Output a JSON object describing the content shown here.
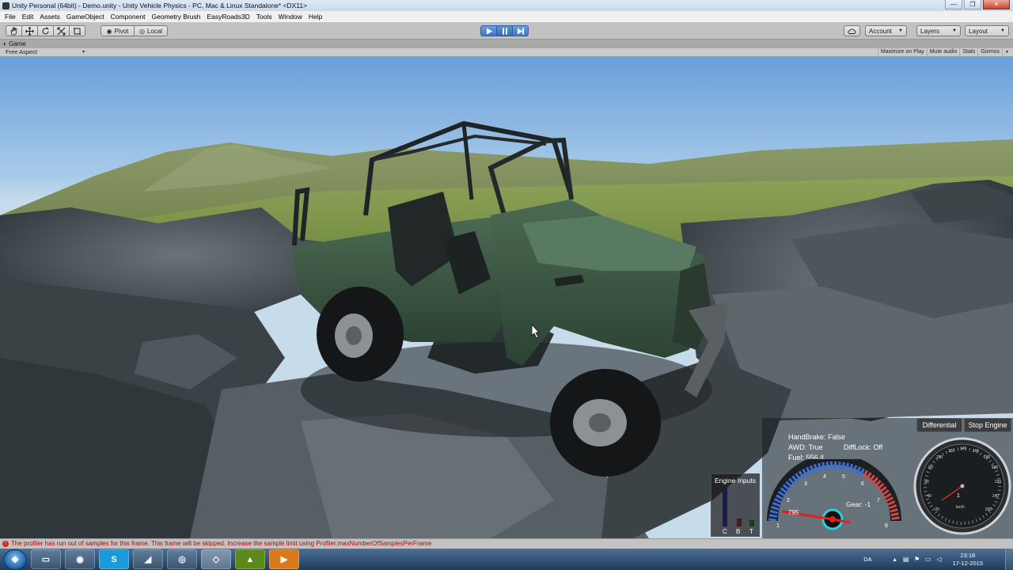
{
  "window": {
    "title": "Unity Personal (64bit) - Demo.unity - Unity Vehicle Physics - PC, Mac & Linux Standalone* <DX11>",
    "minimize": "—",
    "maximize": "❐",
    "close": "✕"
  },
  "menu": [
    "File",
    "Edit",
    "Assets",
    "GameObject",
    "Component",
    "Geometry Brush",
    "EasyRoads3D",
    "Tools",
    "Window",
    "Help"
  ],
  "toolbar": {
    "pivot": "Pivot",
    "local": "Local",
    "account": "Account",
    "layers": "Layers",
    "layout": "Layout"
  },
  "game_tab": {
    "label": "Game"
  },
  "game_bar": {
    "aspect": "Free Aspect",
    "maximize_on_play": "Maximize on Play",
    "mute_audio": "Mute audio",
    "stats": "Stats",
    "gizmos": "Gizmos"
  },
  "hud": {
    "differential": "Differential",
    "stop_engine": "Stop Engine",
    "handbrake": "HandBrake: False",
    "awd": "AWD: True",
    "difflock": "DiffLock: Off",
    "fuel": "Fuel: 556 /L",
    "engine_inputs": "Engine Inputs",
    "input_c": "C",
    "input_b": "B",
    "input_t": "T",
    "rpm": "795",
    "gear": "Gear: -1",
    "tach_ticks": [
      "1",
      "2",
      "3",
      "4",
      "5",
      "6",
      "7",
      "8"
    ],
    "speed_value": "1",
    "speed_unit": "km/h",
    "speed_ticks": [
      "20",
      "40",
      "60",
      "80",
      "100",
      "120",
      "140",
      "160",
      "180",
      "200",
      "220",
      "240",
      "260"
    ]
  },
  "status": {
    "message": "The profiler has run out of samples for this frame. This frame will be skipped. Increase the sample limit using Profiler.maxNumberOfSamplesPerFrame"
  },
  "taskbar": {
    "start_glyph": "❖",
    "apps": [
      {
        "name": "explorer",
        "glyph": "▭"
      },
      {
        "name": "chrome",
        "glyph": "◉"
      },
      {
        "name": "skype",
        "glyph": "S"
      },
      {
        "name": "unknown",
        "glyph": "◢"
      },
      {
        "name": "steam",
        "glyph": "◎"
      },
      {
        "name": "unity",
        "glyph": "◇"
      },
      {
        "name": "nvidia",
        "glyph": "▲"
      },
      {
        "name": "media",
        "glyph": "▶"
      }
    ],
    "lang": "DA",
    "time": "23:18",
    "date": "17-12-2015"
  }
}
